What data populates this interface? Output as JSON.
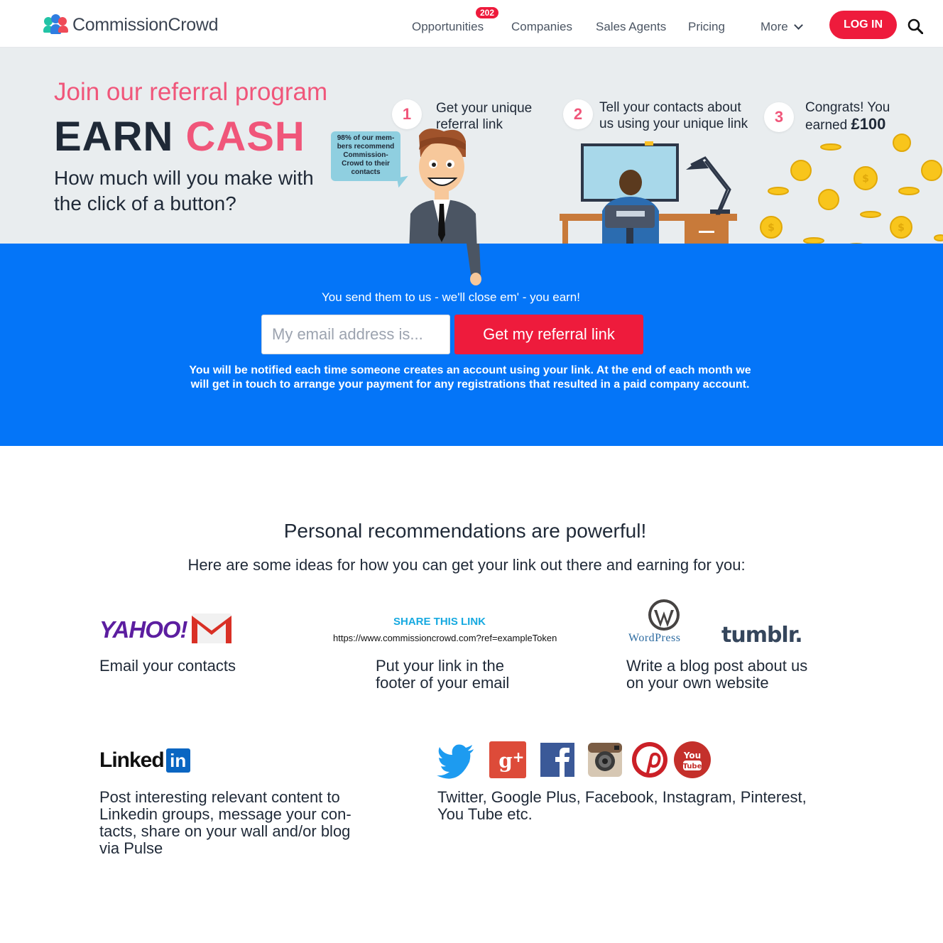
{
  "header": {
    "brand": "CommissionCrowd",
    "nav": {
      "opportunities": "Opportunities",
      "opportunities_badge": "202",
      "companies": "Companies",
      "sales_agents": "Sales Agents",
      "pricing": "Pricing",
      "more": "More"
    },
    "login": "LOG IN"
  },
  "hero": {
    "join": "Join our referral program",
    "earn": "EARN",
    "cash": "CASH",
    "question": "How much will you make with the click of a button?",
    "bubble": "98% of our mem-bers recommend Commission-Crowd to their contacts",
    "steps": [
      {
        "number": "1",
        "text": "Get your unique referral link"
      },
      {
        "number": "2",
        "text": "Tell your contacts about us using your unique link"
      },
      {
        "number": "3",
        "text_before": "Congrats! You earned",
        "amount": "£100"
      }
    ]
  },
  "referral": {
    "tagline": "You send them to us - we'll close em' - you earn!",
    "email_placeholder": "My email address is...",
    "button": "Get my referral link",
    "note": "You will be notified each time someone creates an account using your link. At the end of each month we will get in touch to arrange your payment for any registrations that resulted in a paid company account."
  },
  "ideas": {
    "title": "Personal recommendations are powerful!",
    "subtitle": "Here are some ideas for how you can get your link out there and earning for you:",
    "yahoo_logo": "YAHOO!",
    "email_contacts": "Email your contacts",
    "share_title": "SHARE THIS LINK",
    "share_url": "https://www.commissioncrowd.com?ref=exampleToken",
    "footer": "Put your link in the footer of your email",
    "wordpress_logo": "WordPress",
    "tumblr_logo": "tumblr.",
    "blog": "Write a blog post about us on your own website",
    "linkedin_word": "Linked",
    "linkedin_in": "in",
    "linkedin_text": "Post interesting relevant content to Linkedin groups, message your con-tacts, share on your wall and/or blog via Pulse",
    "social_text": "Twitter, Google Plus, Facebook, Instagram, Pinterest, You Tube etc.",
    "social_icons": [
      "twitter-icon",
      "google-plus-icon",
      "facebook-icon",
      "instagram-icon",
      "pinterest-icon",
      "youtube-icon"
    ]
  },
  "colors": {
    "accent_pink": "#f0567a",
    "brand_red": "#ee1b3c",
    "band_blue": "#0475f8",
    "hero_bg": "#e9edef"
  }
}
